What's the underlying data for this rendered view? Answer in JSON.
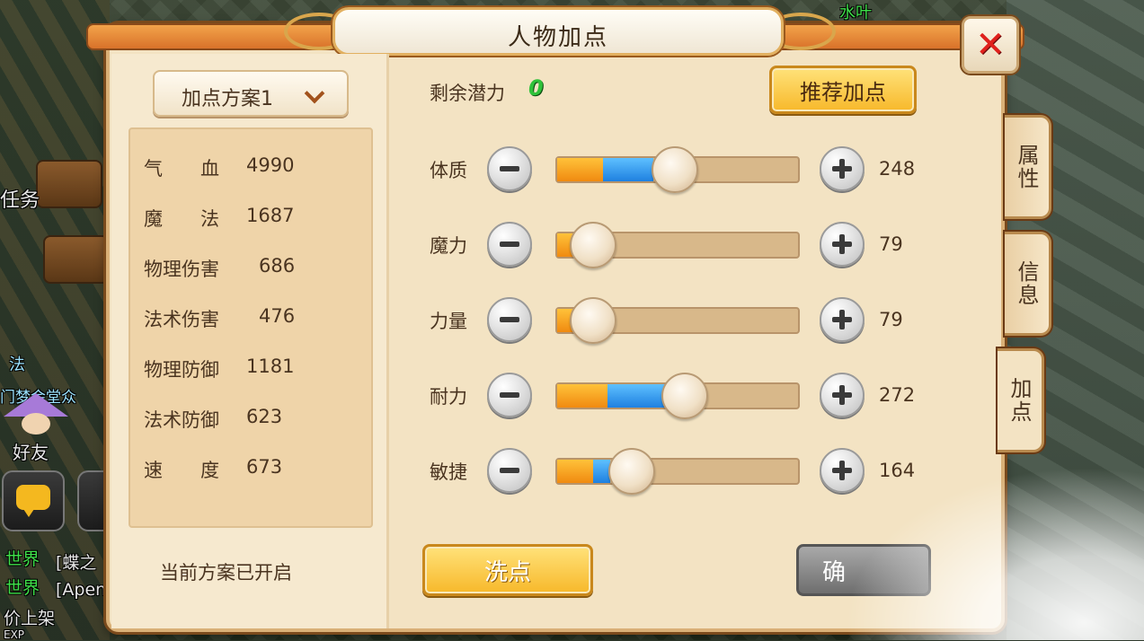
{
  "window": {
    "title": "人物加点",
    "close_label": "✕"
  },
  "scheme": {
    "selected": "加点方案1",
    "status": "当前方案已开启"
  },
  "stats": [
    {
      "label": "气　　血",
      "value": "4990"
    },
    {
      "label": "魔　　法",
      "value": "1687"
    },
    {
      "label": "物理伤害",
      "value": "686"
    },
    {
      "label": "法术伤害",
      "value": "476"
    },
    {
      "label": "物理防御",
      "value": "1181"
    },
    {
      "label": "法术防御",
      "value": "623"
    },
    {
      "label": "速　　度",
      "value": "673"
    }
  ],
  "potential": {
    "label": "剩余潜力",
    "value": "0"
  },
  "buttons": {
    "recommend": "推荐加点",
    "reset": "洗点",
    "confirm": "确"
  },
  "attributes": [
    {
      "label": "体质",
      "value": "248",
      "base_pct": 0.19,
      "added_pct": 0.21,
      "slider_pct": 0.49
    },
    {
      "label": "魔力",
      "value": "79",
      "base_pct": 0.15,
      "added_pct": 0.0,
      "slider_pct": 0.15
    },
    {
      "label": "力量",
      "value": "79",
      "base_pct": 0.15,
      "added_pct": 0.0,
      "slider_pct": 0.15
    },
    {
      "label": "耐力",
      "value": "272",
      "base_pct": 0.21,
      "added_pct": 0.24,
      "slider_pct": 0.53
    },
    {
      "label": "敏捷",
      "value": "164",
      "base_pct": 0.15,
      "added_pct": 0.07,
      "slider_pct": 0.31
    }
  ],
  "side_tabs": [
    {
      "label": "属性",
      "active": false
    },
    {
      "label": "信息",
      "active": false
    },
    {
      "label": "加点",
      "active": true
    }
  ],
  "background": {
    "top_name": "水叶",
    "task": "任务",
    "friend": "好友",
    "chat_lines": [
      {
        "channel": "世界",
        "text": "[蝶之"
      },
      {
        "channel": "世界",
        "text": "[Apen"
      }
    ],
    "bottom_text": "价上架",
    "exp": "EXP",
    "left_text_1": "法",
    "left_text_2": "门梦会堂众"
  },
  "colors": {
    "accent": "#f7b82a",
    "close": "#e0201c",
    "potential": "#2fc23a",
    "fill_orange": "#f08a10",
    "fill_blue": "#1e80e0"
  }
}
